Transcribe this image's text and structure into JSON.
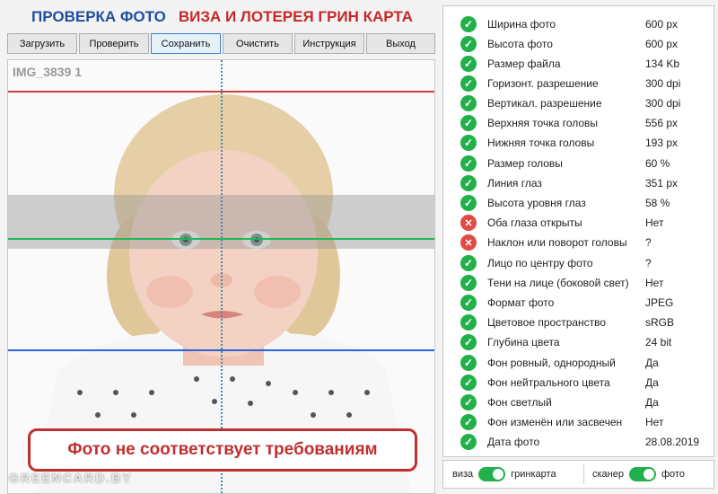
{
  "header": {
    "title_left": "ПРОВЕРКА ФОТО",
    "title_right": "ВИЗА И ЛОТЕРЕЯ ГРИН КАРТА"
  },
  "toolbar": {
    "buttons": [
      {
        "label": "Загрузить",
        "active": false
      },
      {
        "label": "Проверить",
        "active": false
      },
      {
        "label": "Сохранить",
        "active": true
      },
      {
        "label": "Очистить",
        "active": false
      },
      {
        "label": "Инструкция",
        "active": false
      },
      {
        "label": "Выход",
        "active": false
      }
    ]
  },
  "photo": {
    "file_name": "IMG_3839 1",
    "status_message": "Фото не соответствует требованиям",
    "watermark": "GREENCARD.BY",
    "guide_colors": {
      "top": "#c84040",
      "eye": "#1db954",
      "chin": "#2b63d9"
    }
  },
  "checks": [
    {
      "label": "Ширина фото",
      "value": "600 px",
      "ok": true
    },
    {
      "label": "Высота фото",
      "value": "600 px",
      "ok": true
    },
    {
      "label": "Размер файла",
      "value": "134 Kb",
      "ok": true
    },
    {
      "label": "Горизонт. разрешение",
      "value": "300 dpi",
      "ok": true
    },
    {
      "label": "Вертикал. разрешение",
      "value": "300 dpi",
      "ok": true
    },
    {
      "label": "Верхняя точка головы",
      "value": "556 px",
      "ok": true
    },
    {
      "label": "Нижняя точка головы",
      "value": "193 px",
      "ok": true
    },
    {
      "label": "Размер головы",
      "value": "60 %",
      "ok": true
    },
    {
      "label": "Линия глаз",
      "value": "351 px",
      "ok": true
    },
    {
      "label": "Высота уровня глаз",
      "value": "58 %",
      "ok": true
    },
    {
      "label": "Оба глаза открыты",
      "value": "Нет",
      "ok": false
    },
    {
      "label": "Наклон или поворот головы",
      "value": "?",
      "ok": false
    },
    {
      "label": "Лицо по центру фото",
      "value": "?",
      "ok": true
    },
    {
      "label": "Тени на лице (боковой свет)",
      "value": "Нет",
      "ok": true
    },
    {
      "label": "Формат фото",
      "value": "JPEG",
      "ok": true
    },
    {
      "label": "Цветовое пространство",
      "value": "sRGB",
      "ok": true
    },
    {
      "label": "Глубина цвета",
      "value": "24 bit",
      "ok": true
    },
    {
      "label": "Фон ровный, однородный",
      "value": "Да",
      "ok": true
    },
    {
      "label": "Фон нейтрального цвета",
      "value": "Да",
      "ok": true
    },
    {
      "label": "Фон светлый",
      "value": "Да",
      "ok": true
    },
    {
      "label": "Фон изменён или засвечен",
      "value": "Нет",
      "ok": true
    },
    {
      "label": "Дата фото",
      "value": "28.08.2019",
      "ok": true
    }
  ],
  "toggles": {
    "mode_left": "виза",
    "mode_right": "гринкарта",
    "source_left": "сканер",
    "source_right": "фото",
    "accent": "#22b04a"
  }
}
